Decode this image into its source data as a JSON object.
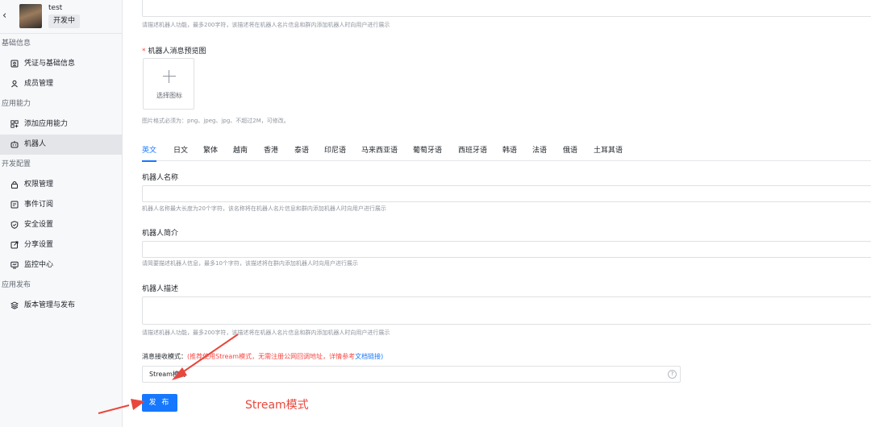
{
  "app": {
    "name": "test",
    "status": "开发中"
  },
  "sidebar": {
    "groups": [
      {
        "title": "基础信息",
        "items": [
          {
            "label": "凭证与基础信息",
            "icon": "credential-icon"
          },
          {
            "label": "成员管理",
            "icon": "user-icon"
          }
        ]
      },
      {
        "title": "应用能力",
        "items": [
          {
            "label": "添加应用能力",
            "icon": "apps-icon"
          },
          {
            "label": "机器人",
            "icon": "robot-icon",
            "active": true
          }
        ]
      },
      {
        "title": "开发配置",
        "items": [
          {
            "label": "权限管理",
            "icon": "lock-icon"
          },
          {
            "label": "事件订阅",
            "icon": "event-icon"
          },
          {
            "label": "安全设置",
            "icon": "shield-icon"
          },
          {
            "label": "分享设置",
            "icon": "share-icon"
          },
          {
            "label": "监控中心",
            "icon": "monitor-icon"
          }
        ]
      },
      {
        "title": "应用发布",
        "items": [
          {
            "label": "版本管理与发布",
            "icon": "layers-icon"
          }
        ]
      }
    ]
  },
  "form": {
    "top_hint": "请描述机器人功能，最多200字符，该描述将在机器人名片信息和群内添加机器人时向用户进行展示",
    "preview": {
      "label": "机器人消息预览图",
      "upload_label": "选择图标",
      "hint": "图片格式必须为：png、jpeg、jpg、不超过2M，可修改。"
    },
    "languages": [
      "英文",
      "日文",
      "繁体",
      "越南",
      "香港",
      "泰语",
      "印尼语",
      "马来西亚语",
      "葡萄牙语",
      "西班牙语",
      "韩语",
      "法语",
      "俄语",
      "土耳其语"
    ],
    "active_language": "英文",
    "name": {
      "label": "机器人名称",
      "value": "",
      "hint": "机器人名称最大长度为20个字符，该名称将在机器人名片信息和群内添加机器人时向用户进行展示"
    },
    "intro": {
      "label": "机器人简介",
      "value": "",
      "hint": "请简要描述机器人信息，最多10个字符，该描述将在群内添加机器人时向用户进行展示"
    },
    "description": {
      "label": "机器人描述",
      "value": "",
      "hint": "请描述机器人功能，最多200字符，该描述将在机器人名片信息和群内添加机器人时向用户进行展示"
    },
    "receive_mode": {
      "label": "消息接收模式：",
      "note": "(推荐使用Stream模式，无需注册公网回调地址，详情参考",
      "link": "文档链接",
      "close": ")",
      "value": "Stream模式",
      "help_icon": "?"
    },
    "publish_label": "发 布"
  },
  "annotation": {
    "text": "Stream模式",
    "color": "#e8473d"
  },
  "colors": {
    "primary": "#1677ff",
    "danger": "#f54a45"
  }
}
